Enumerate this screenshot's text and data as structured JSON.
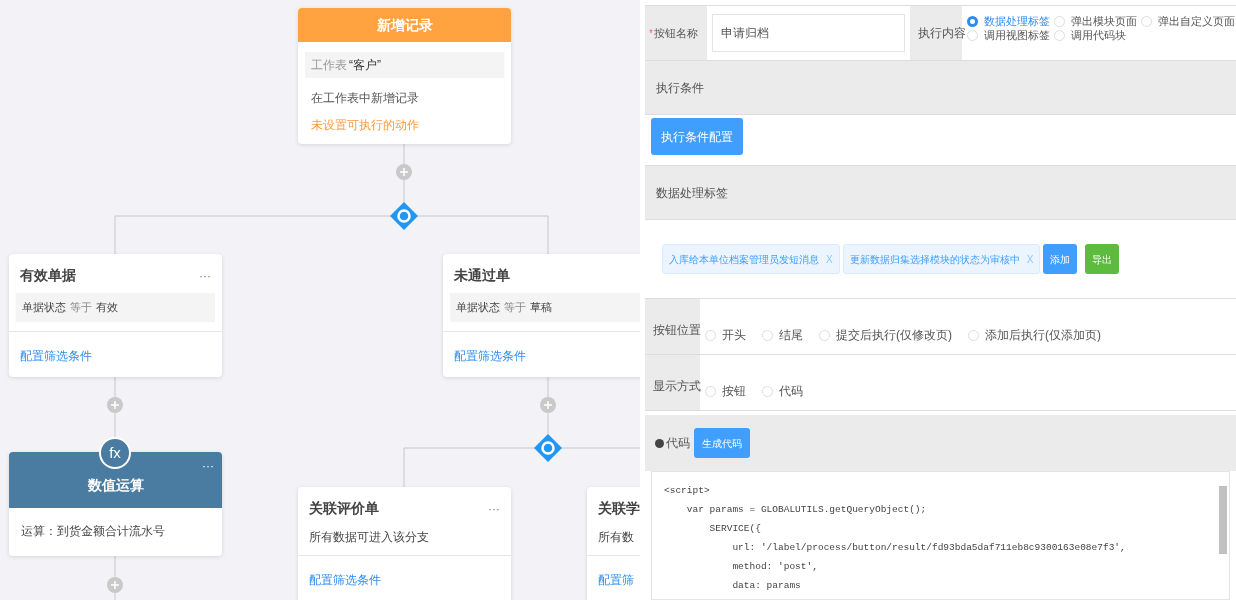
{
  "flow": {
    "nodes": [
      {
        "kind": "action",
        "title": "新增记录",
        "table_label": "工作表",
        "table_name": "“客户”",
        "description": "在工作表中新增记录",
        "warning": "未设置可执行的动作"
      },
      {
        "kind": "filter",
        "title": "有效单据",
        "menu": "···",
        "condition": {
          "field": "单据状态",
          "operator": "等于",
          "value": "有效"
        },
        "link": "配置筛选条件"
      },
      {
        "kind": "filter",
        "title": "未通过单",
        "condition": {
          "field": "单据状态",
          "operator": "等于",
          "value": "草稿"
        },
        "link": "配置筛选条件"
      },
      {
        "kind": "calc",
        "badge": "fx",
        "title": "数值运算",
        "menu": "···",
        "body": "运算：到货金额合计流水号"
      },
      {
        "kind": "branch",
        "title": "关联评价单",
        "menu": "···",
        "description": "所有数据可进入该分支",
        "link": "配置筛选条件"
      },
      {
        "kind": "branch",
        "title": "关联学",
        "description": "所有数",
        "link": "配置筛"
      }
    ]
  },
  "form": {
    "button_name": {
      "required_mark": "*",
      "label": "按钮名称",
      "value": "申请归档"
    },
    "exec_content": {
      "label": "执行内容",
      "options": [
        {
          "label": "数据处理标签",
          "selected": true
        },
        {
          "label": "弹出模块页面",
          "selected": false
        },
        {
          "label": "弹出自定义页面",
          "selected": false
        },
        {
          "label": "调用视图标签",
          "selected": false
        },
        {
          "label": "调用代码块",
          "selected": false
        }
      ]
    },
    "exec_condition": {
      "title": "执行条件",
      "button": "执行条件配置"
    },
    "data_tags": {
      "title": "数据处理标签",
      "tags": [
        {
          "label": "入库给本单位档案管理员发短消息",
          "close": "X"
        },
        {
          "label": "更新数据归集选择模块的状态为审核中",
          "close": "X"
        }
      ],
      "buttons": [
        {
          "label": "添加",
          "kind": "primary"
        },
        {
          "label": "导出",
          "kind": "success"
        }
      ]
    },
    "position": {
      "label": "按钮位置",
      "options": [
        {
          "label": "开头",
          "selected": false
        },
        {
          "label": "结尾",
          "selected": false
        },
        {
          "label": "提交后执行(仅修改页)",
          "selected": false
        },
        {
          "label": "添加后执行(仅添加页)",
          "selected": false
        }
      ]
    },
    "display": {
      "label": "显示方式",
      "options": [
        {
          "label": "按钮",
          "selected": false
        },
        {
          "label": "代码",
          "selected": false
        }
      ]
    },
    "code": {
      "label": "代码",
      "button": "生成代码",
      "lines": [
        "<script>",
        "    var params = GLOBALUTILS.getQueryObject();",
        "        SERVICE({",
        "            url: '/label/process/button/result/fd93bda5daf711eb8c9300163e08e7f3',",
        "            method: 'post',",
        "            data: params"
      ]
    }
  }
}
